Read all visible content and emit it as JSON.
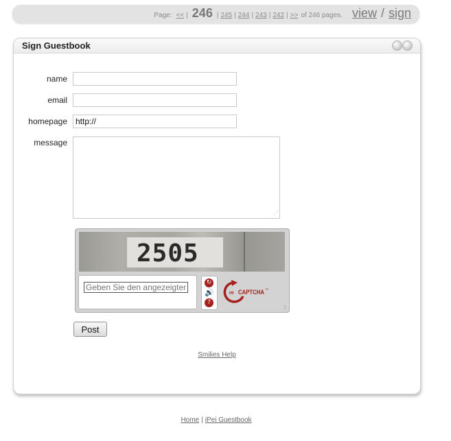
{
  "pager": {
    "page_label": "Page:",
    "first": "<<",
    "current": "246",
    "pages": [
      "245",
      "244",
      "243",
      "242"
    ],
    "last": ">>",
    "of_text": "of 246 pages.",
    "view": "view",
    "slash": "/",
    "sign": "sign"
  },
  "panel": {
    "title": "Sign Guestbook",
    "fields": {
      "name_label": "name",
      "email_label": "email",
      "homepage_label": "homepage",
      "homepage_value": "http://",
      "message_label": "message"
    },
    "captcha": {
      "word": "2505",
      "placeholder": "Geben Sie den angezeigten Text ein",
      "reload_icon": "reload-icon",
      "audio_icon": "audio-icon",
      "help_icon": "help-icon",
      "logo_text": "reCAPTCHA",
      "logo_prefix": "re",
      "logo_main": "CAPTCHA",
      "logo_tm": "™",
      "accent": "#a6201c"
    },
    "post_label": "Post",
    "smilies_link": "Smilies Help"
  },
  "footer": {
    "home": "Home",
    "sep": "|",
    "app": "iPei Guestbook"
  }
}
